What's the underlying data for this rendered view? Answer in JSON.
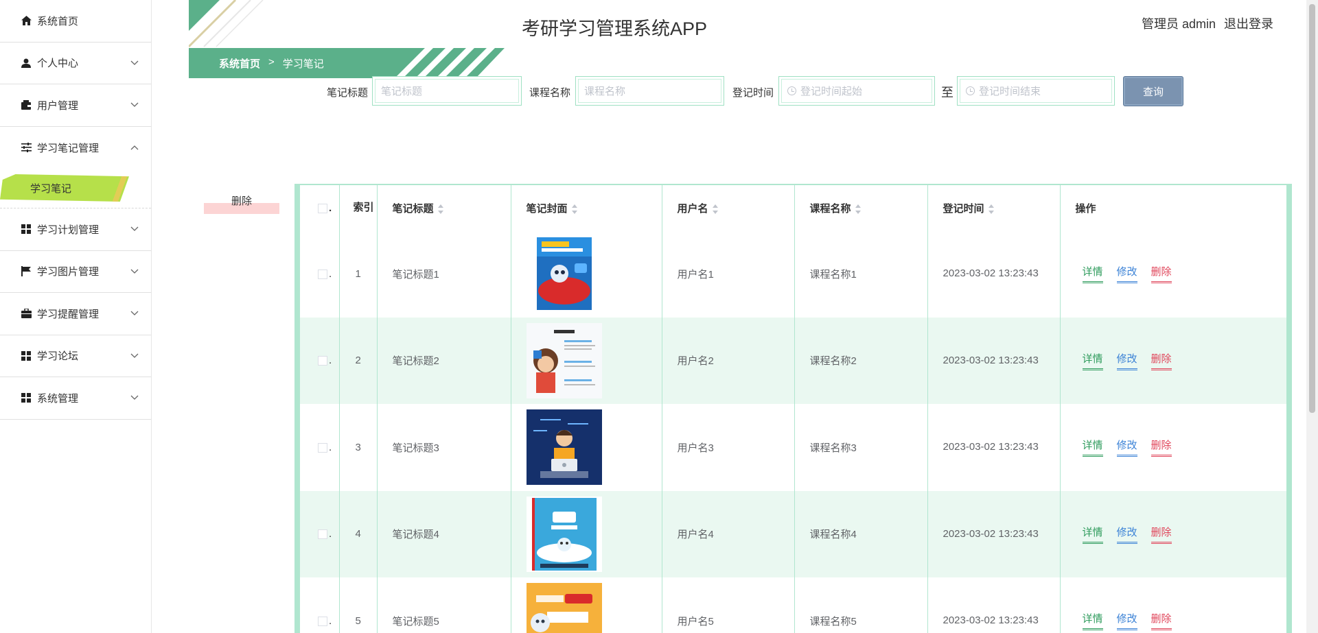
{
  "app": {
    "title": "考研学习管理系统APP"
  },
  "user": {
    "role_label": "管理员",
    "name": "admin",
    "logout": "退出登录"
  },
  "breadcrumb": {
    "home": "系统首页",
    "sep": ">",
    "current": "学习笔记"
  },
  "sidebar": {
    "items": [
      {
        "label": "系统首页",
        "icon": "home-icon"
      },
      {
        "label": "个人中心",
        "icon": "user-icon"
      },
      {
        "label": "用户管理",
        "icon": "wallet-icon"
      },
      {
        "label": "学习笔记管理",
        "icon": "sliders-icon",
        "open": true
      },
      {
        "label": "学习计划管理",
        "icon": "grid-icon"
      },
      {
        "label": "学习图片管理",
        "icon": "flag-icon"
      },
      {
        "label": "学习提醒管理",
        "icon": "briefcase-icon"
      },
      {
        "label": "学习论坛",
        "icon": "grid-icon"
      },
      {
        "label": "系统管理",
        "icon": "grid-icon"
      }
    ],
    "sub_active": "学习笔记"
  },
  "search": {
    "title_label": "笔记标题",
    "title_placeholder": "笔记标题",
    "course_label": "课程名称",
    "course_placeholder": "课程名称",
    "time_label": "登记时间",
    "time_start_placeholder": "登记时间起始",
    "to": "至",
    "time_end_placeholder": "登记时间结束",
    "query": "查询"
  },
  "actions": {
    "delete": "删除"
  },
  "table": {
    "headers": {
      "index": "索引",
      "title": "笔记标题",
      "cover": "笔记封面",
      "user": "用户名",
      "course": "课程名称",
      "time": "登记时间",
      "ops": "操作"
    },
    "ops": {
      "detail": "详情",
      "edit": "修改",
      "remove": "删除"
    },
    "rows": [
      {
        "index": "1",
        "title": "笔记标题1",
        "user": "用户名1",
        "course": "课程名称1",
        "time": "2023-03-02 13:23:43",
        "cover": "cover-1"
      },
      {
        "index": "2",
        "title": "笔记标题2",
        "user": "用户名2",
        "course": "课程名称2",
        "time": "2023-03-02 13:23:43",
        "cover": "cover-2"
      },
      {
        "index": "3",
        "title": "笔记标题3",
        "user": "用户名3",
        "course": "课程名称3",
        "time": "2023-03-02 13:23:43",
        "cover": "cover-3"
      },
      {
        "index": "4",
        "title": "笔记标题4",
        "user": "用户名4",
        "course": "课程名称4",
        "time": "2023-03-02 13:23:43",
        "cover": "cover-4"
      },
      {
        "index": "5",
        "title": "笔记标题5",
        "user": "用户名5",
        "course": "课程名称5",
        "time": "2023-03-02 13:23:43",
        "cover": "cover-5"
      }
    ]
  },
  "colors": {
    "accent": "#5bb08a",
    "row_alt": "#eaf8f1",
    "border": "#b0e6cf",
    "submenu_bg": "#b6e04a",
    "query_btn": "#7b93b0"
  }
}
